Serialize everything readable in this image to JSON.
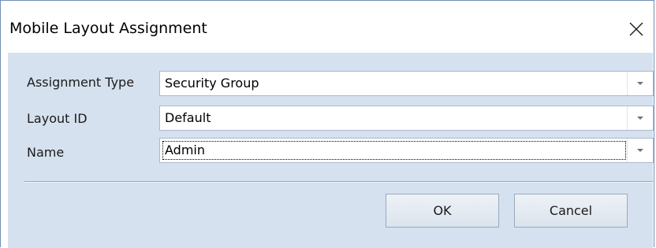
{
  "dialog": {
    "title": "Mobile Layout Assignment",
    "close_icon": "close-icon"
  },
  "fields": [
    {
      "label": "Assignment Type",
      "value": "Security Group",
      "focused": false
    },
    {
      "label": "Layout ID",
      "value": "Default",
      "focused": false
    },
    {
      "label": "Name",
      "value": "Admin",
      "focused": true
    }
  ],
  "buttons": {
    "ok_label": "OK",
    "cancel_label": "Cancel"
  },
  "colors": {
    "client_background": "#d6e1ef",
    "window_border": "#6f8fb5"
  }
}
